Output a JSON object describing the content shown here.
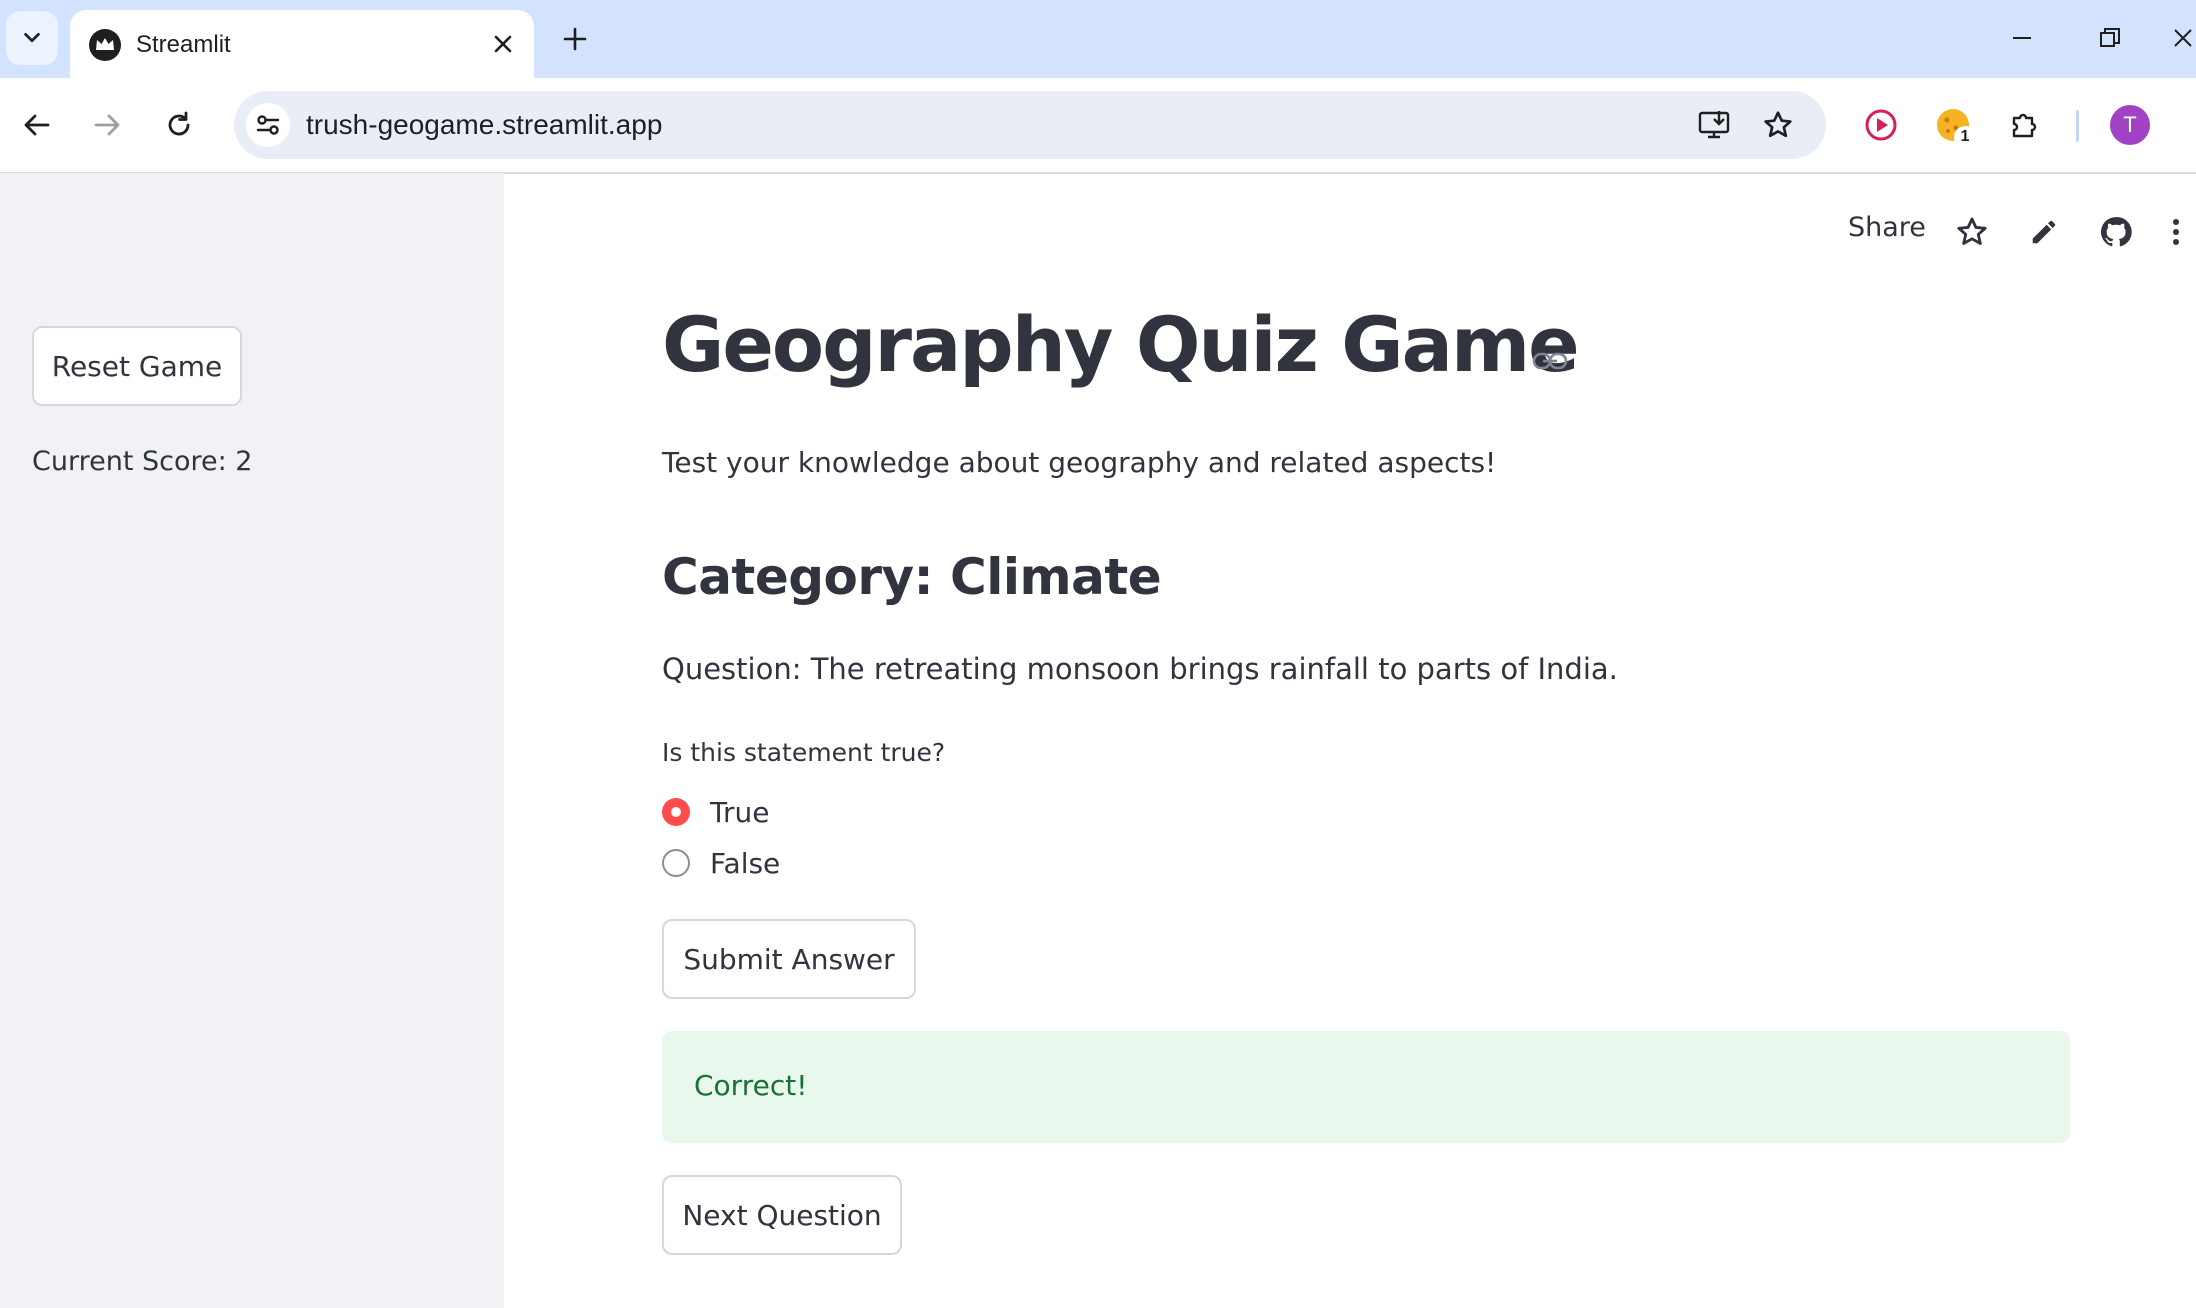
{
  "browser": {
    "tab_title": "Streamlit",
    "url": "trush-geogame.streamlit.app",
    "extension_badge": "1",
    "profile_initial": "T",
    "accent_color": "#d3e3fd"
  },
  "app_header": {
    "share_label": "Share"
  },
  "sidebar": {
    "reset_button_label": "Reset Game",
    "score_text": "Current Score: 2"
  },
  "main": {
    "title": "Geography Quiz Game",
    "subtitle": "Test your knowledge about geography and related aspects!",
    "category": "Category: Climate",
    "question": "Question: The retreating monsoon brings rainfall to parts of India.",
    "radio_label": "Is this statement true?",
    "options": [
      {
        "label": "True",
        "selected": true
      },
      {
        "label": "False",
        "selected": false
      }
    ],
    "submit_label": "Submit Answer",
    "result_text": "Correct!",
    "next_label": "Next Question",
    "primary_color": "#ff4b4b",
    "success_bg": "#e8f8ec",
    "success_text_color": "#177233"
  }
}
